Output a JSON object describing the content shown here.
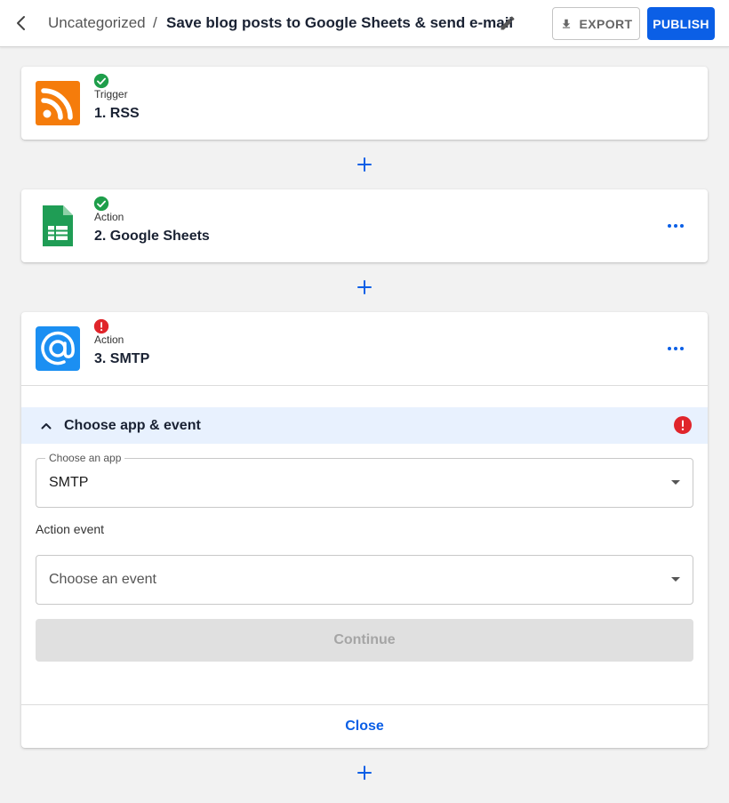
{
  "header": {
    "breadcrumb_parent": "Uncategorized",
    "breadcrumb_separator": "/",
    "flow_title": "Save blog posts to Google Sheets & send e-mail",
    "export_label": "EXPORT",
    "publish_label": "PUBLISH"
  },
  "steps": [
    {
      "type": "Trigger",
      "name": "1. RSS",
      "app_icon": "rss-icon",
      "status": "success",
      "has_menu": false
    },
    {
      "type": "Action",
      "name": "2. Google Sheets",
      "app_icon": "google-sheets-icon",
      "status": "success",
      "has_menu": true
    },
    {
      "type": "Action",
      "name": "3. SMTP",
      "app_icon": "smtp-at-icon",
      "status": "error",
      "has_menu": true
    }
  ],
  "editor": {
    "section_title": "Choose app & event",
    "app_select": {
      "legend": "Choose an app",
      "value": "SMTP"
    },
    "event_label": "Action event",
    "event_select": {
      "placeholder": "Choose an event"
    },
    "continue_label": "Continue",
    "close_label": "Close"
  },
  "colors": {
    "primary": "#0b5fe6",
    "success": "#1e9e4a",
    "error": "#e0252b",
    "rss": "#f57c0b",
    "sheets": "#1f9d55",
    "smtp": "#1b8ff2",
    "section_bg": "#e8f1fe"
  }
}
